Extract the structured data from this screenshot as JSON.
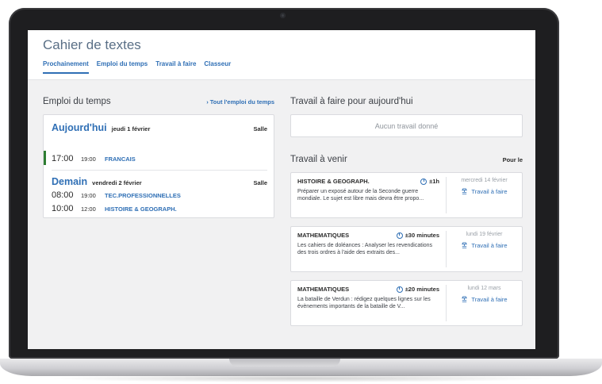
{
  "app": {
    "title": "Cahier de textes",
    "tabs": [
      {
        "label": "Prochainement",
        "active": true
      },
      {
        "label": "Emploi du temps",
        "active": false
      },
      {
        "label": "Travail à faire",
        "active": false
      },
      {
        "label": "Classeur",
        "active": false
      }
    ]
  },
  "schedule": {
    "title": "Emploi du temps",
    "link": "› Tout l'emploi du temps",
    "days": [
      {
        "name": "Aujourd'hui",
        "date": "jeudi 1 février",
        "room_header": "Salle",
        "lessons": [
          {
            "start": "17:00",
            "end": "19:00",
            "subject": "FRANCAIS"
          }
        ]
      },
      {
        "name": "Demain",
        "date": "vendredi 2 février",
        "room_header": "Salle",
        "lessons": [
          {
            "start": "08:00",
            "end": "19:00",
            "subject": "TEC.PROFESSIONNELLES"
          },
          {
            "start": "10:00",
            "end": "12:00",
            "subject": "HISTOIRE & GEOGRAPH."
          }
        ]
      }
    ]
  },
  "today_homework": {
    "title": "Travail à faire pour aujourd'hui",
    "empty_text": "Aucun travail donné"
  },
  "upcoming": {
    "title": "Travail à venir",
    "right_label": "Pour le",
    "items": [
      {
        "subject": "HISTOIRE & GEOGRAPH.",
        "duration": "±1h",
        "description": "Préparer un exposé autour de la Seconde guerre mondiale. Le sujet est libre mais devra être propo...",
        "due_date": "mercredi 14 février",
        "action": "Travail à faire"
      },
      {
        "subject": "MATHEMATIQUES",
        "duration": "±30 minutes",
        "description": "Les cahiers de doléances : Analyser les revendications des trois ordres à l'aide des extraits des...",
        "due_date": "lundi 19 février",
        "action": "Travail à faire"
      },
      {
        "subject": "MATHEMATIQUES",
        "duration": "±20 minutes",
        "description": "La bataille de Verdun : rédigez quelques lignes sur les évènements importants de la bataille de V...",
        "due_date": "lundi 12 mars",
        "action": "Travail à faire"
      }
    ]
  },
  "colors": {
    "accent": "#2f6fb5",
    "current_lesson": "#2e7d32",
    "frame": "#1e1e20"
  }
}
